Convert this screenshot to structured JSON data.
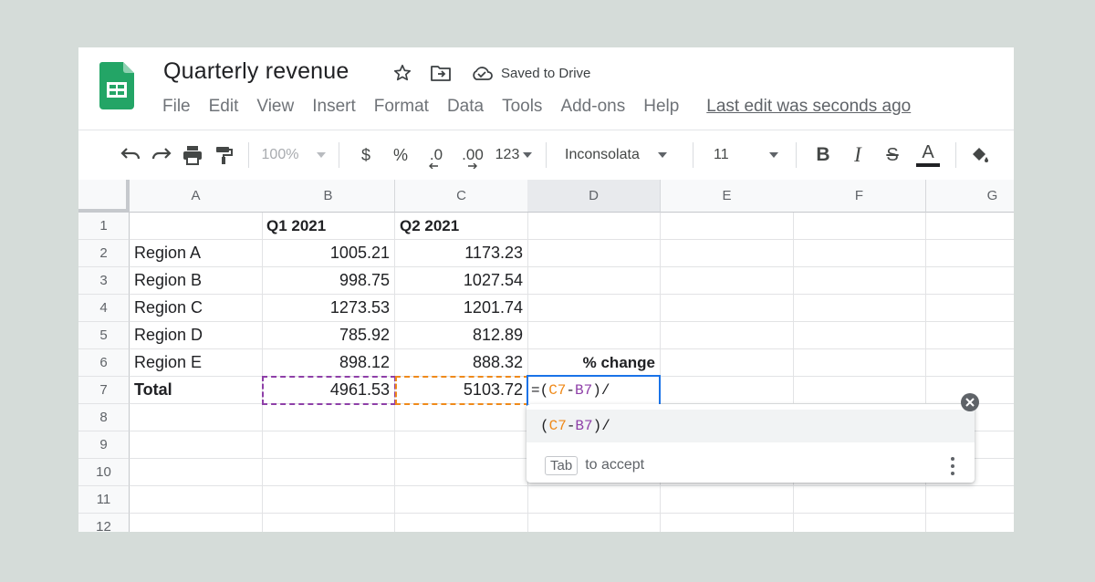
{
  "app": {
    "title": "Quarterly revenue",
    "saved_status": "Saved to Drive"
  },
  "menu": [
    "File",
    "Edit",
    "View",
    "Insert",
    "Format",
    "Data",
    "Tools",
    "Add-ons",
    "Help"
  ],
  "last_edit": "Last edit was seconds ago",
  "toolbar": {
    "zoom": "100%",
    "currency": "$",
    "percent": "%",
    "decrease_decimal": ".0",
    "increase_decimal": ".00",
    "number_format": "123",
    "font": "Inconsolata",
    "font_size": "11",
    "bold": "B",
    "italic": "I",
    "strikethrough": "S",
    "text_color": "A"
  },
  "columns": [
    "A",
    "B",
    "C",
    "D",
    "E",
    "F",
    "G"
  ],
  "rows": [
    "1",
    "2",
    "3",
    "4",
    "5",
    "6",
    "7",
    "8",
    "9",
    "10",
    "11",
    "12"
  ],
  "cells": {
    "B1": "Q1 2021",
    "C1": "Q2 2021",
    "A2": "Region A",
    "B2": "1005.21",
    "C2": "1173.23",
    "A3": "Region B",
    "B3": "998.75",
    "C3": "1027.54",
    "A4": "Region C",
    "B4": "1273.53",
    "C4": "1201.74",
    "A5": "Region D",
    "B5": "785.92",
    "C5": "812.89",
    "A6": "Region E",
    "B6": "898.12",
    "C6": "888.32",
    "D6": "% change",
    "A7": "Total",
    "B7": "4961.53",
    "C7": "5103.72"
  },
  "formula": {
    "prefix": "=(",
    "ref1": "C7",
    "minus": "-",
    "ref2": "B7",
    "suffix": ")/"
  },
  "suggestion": {
    "open": "(",
    "ref1": "C7",
    "minus": "-",
    "ref2": "B7",
    "suffix": ")/",
    "key": "Tab",
    "hint": "to accept"
  },
  "colors": {
    "accent": "#1a73e8",
    "ref_b": "#8e3fa8",
    "ref_c": "#ef8a1a",
    "sheets_green": "#0f9d58"
  }
}
